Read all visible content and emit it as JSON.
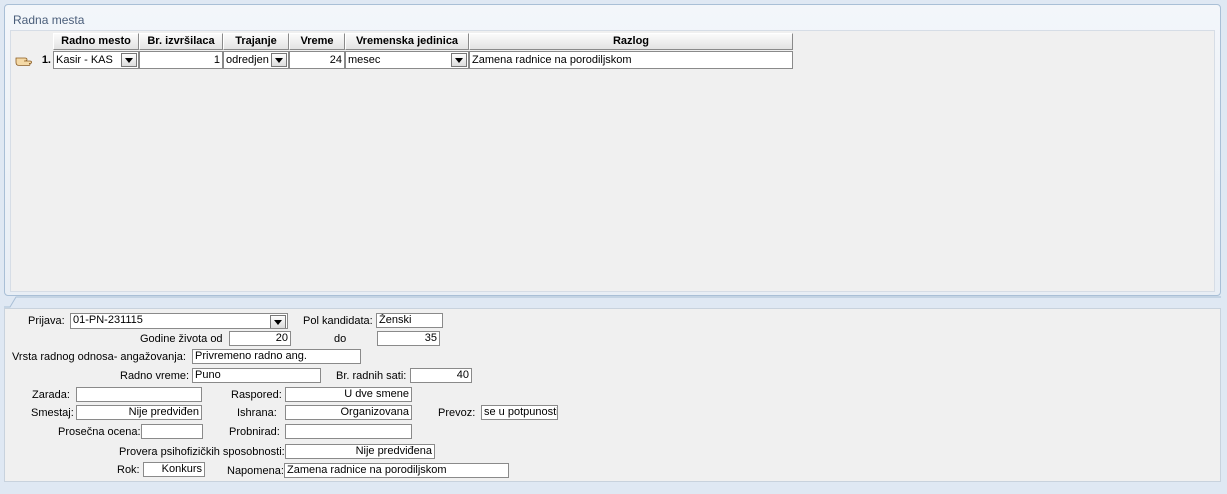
{
  "panel": {
    "title": "Radna mesta"
  },
  "grid": {
    "columns": [
      "Radno mesto",
      "Br. izvršilaca",
      "Trajanje",
      "Vreme",
      "Vremenska jedinica",
      "Razlog"
    ],
    "rows": [
      {
        "number": "1.",
        "radno_mesto": "Kasir - KAS",
        "br_izvrsilaca": "1",
        "trajanje": "odredjen",
        "vreme": "24",
        "vremenska_jedinica": "mesec",
        "razlog": "Zamena radnice na porodiljskom"
      }
    ]
  },
  "form": {
    "prijava_label": "Prijava:",
    "prijava_value": "01-PN-231115",
    "pol_label": "Pol kandidata:",
    "pol_value": "Ženski",
    "godine_label": "Godine života od",
    "godine_od": "20",
    "do_label": "do",
    "godine_do": "35",
    "vrsta_label": "Vrsta radnog odnosa- angažovanja:",
    "vrsta_value": "Privremeno radno ang.",
    "radno_vreme_label": "Radno vreme:",
    "radno_vreme_value": "Puno",
    "br_sati_label": "Br. radnih sati:",
    "br_sati_value": "40",
    "zarada_label": "Zarada:",
    "zarada_value": "",
    "raspored_label": "Raspored:",
    "raspored_value": "U dve smene",
    "smestaj_label": "Smestaj:",
    "smestaj_value": "Nije predviđen",
    "ishrana_label": "Ishrana:",
    "ishrana_value": "Organizovana",
    "prevoz_label": "Prevoz:",
    "prevoz_value": "se u potpunosti",
    "prosecna_label": "Prosečna ocena:",
    "prosecna_value": "",
    "probni_label": "Probnirad:",
    "probni_value": "",
    "provera_label": "Provera psihofizičkih sposobnosti:",
    "provera_value": "Nije predviđena",
    "rok_label": "Rok:",
    "rok_value": "Konkurs",
    "napomena_label": "Napomena:",
    "napomena_value": "Zamena radnice na porodiljskom"
  }
}
